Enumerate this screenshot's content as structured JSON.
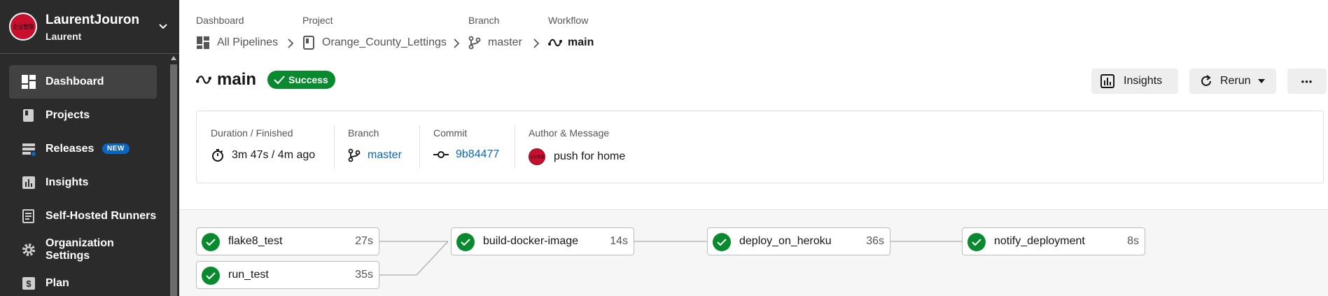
{
  "org": {
    "name": "LaurentJouron",
    "user": "Laurent",
    "avatar_text": "企业管理"
  },
  "nav": {
    "items": [
      {
        "label": "Dashboard",
        "icon": "dashboard-icon",
        "active": true
      },
      {
        "label": "Projects",
        "icon": "book-icon"
      },
      {
        "label": "Releases",
        "icon": "releases-icon",
        "badge": "NEW"
      },
      {
        "label": "Insights",
        "icon": "insights-icon"
      },
      {
        "label": "Self-Hosted Runners",
        "icon": "runners-icon"
      },
      {
        "label": "Organization Settings",
        "icon": "gear-icon"
      },
      {
        "label": "Plan",
        "icon": "plan-icon"
      }
    ]
  },
  "breadcrumb": {
    "labels": {
      "dashboard": "Dashboard",
      "project": "Project",
      "branch": "Branch",
      "workflow": "Workflow"
    },
    "values": {
      "dashboard": "All Pipelines",
      "project": "Orange_County_Lettings",
      "branch": "master",
      "workflow": "main"
    }
  },
  "header": {
    "title": "main",
    "status": "Success",
    "insights_label": "Insights",
    "rerun_label": "Rerun",
    "more_label": "•••"
  },
  "summary": {
    "duration_label": "Duration / Finished",
    "duration_value": "3m 47s / 4m ago",
    "branch_label": "Branch",
    "branch_value": "master",
    "commit_label": "Commit",
    "commit_value": "9b84477",
    "author_label": "Author & Message",
    "author_avatar_text": "企业管理",
    "message": "push for home"
  },
  "jobs": [
    {
      "name": "flake8_test",
      "duration": "27s"
    },
    {
      "name": "run_test",
      "duration": "35s"
    },
    {
      "name": "build-docker-image",
      "duration": "14s"
    },
    {
      "name": "deploy_on_heroku",
      "duration": "36s"
    },
    {
      "name": "notify_deployment",
      "duration": "8s"
    }
  ],
  "colors": {
    "success": "#0a8a2e",
    "link": "#0a66c2",
    "sidebar": "#2b2b2b",
    "badge": "#0a66c2"
  }
}
